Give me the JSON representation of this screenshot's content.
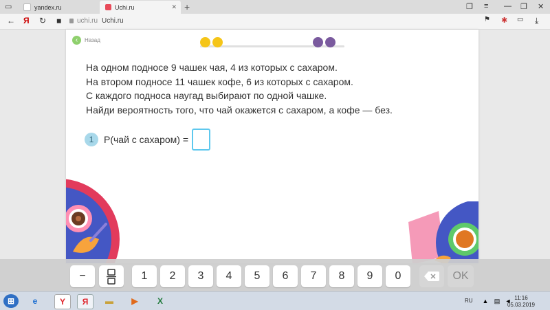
{
  "tabs": [
    {
      "label": "yandex.ru",
      "active": false
    },
    {
      "label": "Uchi.ru",
      "active": true
    }
  ],
  "addressbar": {
    "site_name": "uchi.ru",
    "title": "Uchi.ru"
  },
  "nav": {
    "back_label": "Назад"
  },
  "progress_dots": [
    {
      "color": "#f5c518",
      "state": "done"
    },
    {
      "color": "#f5c518",
      "state": "done"
    },
    {
      "color": "#7a5a9e",
      "state": "todo"
    },
    {
      "color": "#7a5a9e",
      "state": "todo"
    }
  ],
  "problem": {
    "lines": [
      "На одном подносе 9 чашек чая, 4 из которых с сахаром.",
      "На втором подносе 11 чашек кофе, 6 из которых с сахаром.",
      "С каждого подноса наугад выбирают по одной чашке.",
      "Найди вероятность того, что чай окажется с сахаром, а кофе — без."
    ]
  },
  "question": {
    "number": "1",
    "label": "P(чай с сахаром) =",
    "answer_value": ""
  },
  "keypad": {
    "keys": [
      "−",
      "fraction",
      "1",
      "2",
      "3",
      "4",
      "5",
      "6",
      "7",
      "8",
      "9",
      "0",
      "backspace",
      "OK"
    ]
  },
  "taskbar": {
    "language": "RU",
    "time": "11:16",
    "date": "05.03.2019"
  },
  "colors": {
    "accent_blue": "#5ec8ee",
    "back_green": "#8fd06d",
    "badge_blue": "#a8d8ea"
  }
}
